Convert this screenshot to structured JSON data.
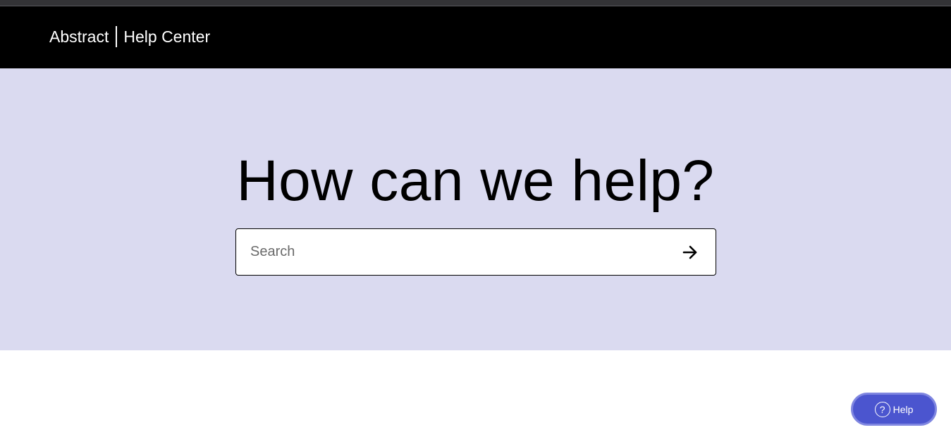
{
  "header": {
    "brand_name": "Abstract",
    "brand_section": "Help Center"
  },
  "hero": {
    "title": "How can we help?",
    "search": {
      "placeholder": "Search",
      "value": "",
      "submit_icon": "arrow-right-icon"
    }
  },
  "help_widget": {
    "label": "Help",
    "icon_glyph": "?",
    "icon": "question-circle-icon"
  },
  "colors": {
    "header_bg": "#000000",
    "hero_bg": "#dadaf0",
    "help_button_bg": "#4b55cf",
    "help_button_border": "#7f86e0"
  }
}
